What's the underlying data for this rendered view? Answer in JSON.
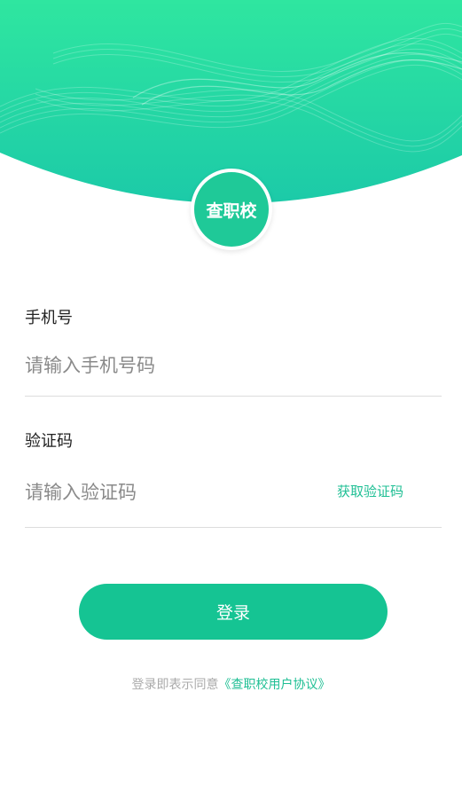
{
  "app": {
    "logo_text": "查职校"
  },
  "form": {
    "phone_label": "手机号",
    "phone_placeholder": "请输入手机号码",
    "phone_value": "",
    "code_label": "验证码",
    "code_placeholder": "请输入验证码",
    "code_value": "",
    "get_code_label": "获取验证码",
    "login_label": "登录"
  },
  "agreement": {
    "prefix": "登录即表示同意",
    "link": "《查职校用户协议》"
  },
  "colors": {
    "accent": "#15c493",
    "header_top": "#2ee6a0",
    "header_bottom": "#1cc9a8"
  }
}
